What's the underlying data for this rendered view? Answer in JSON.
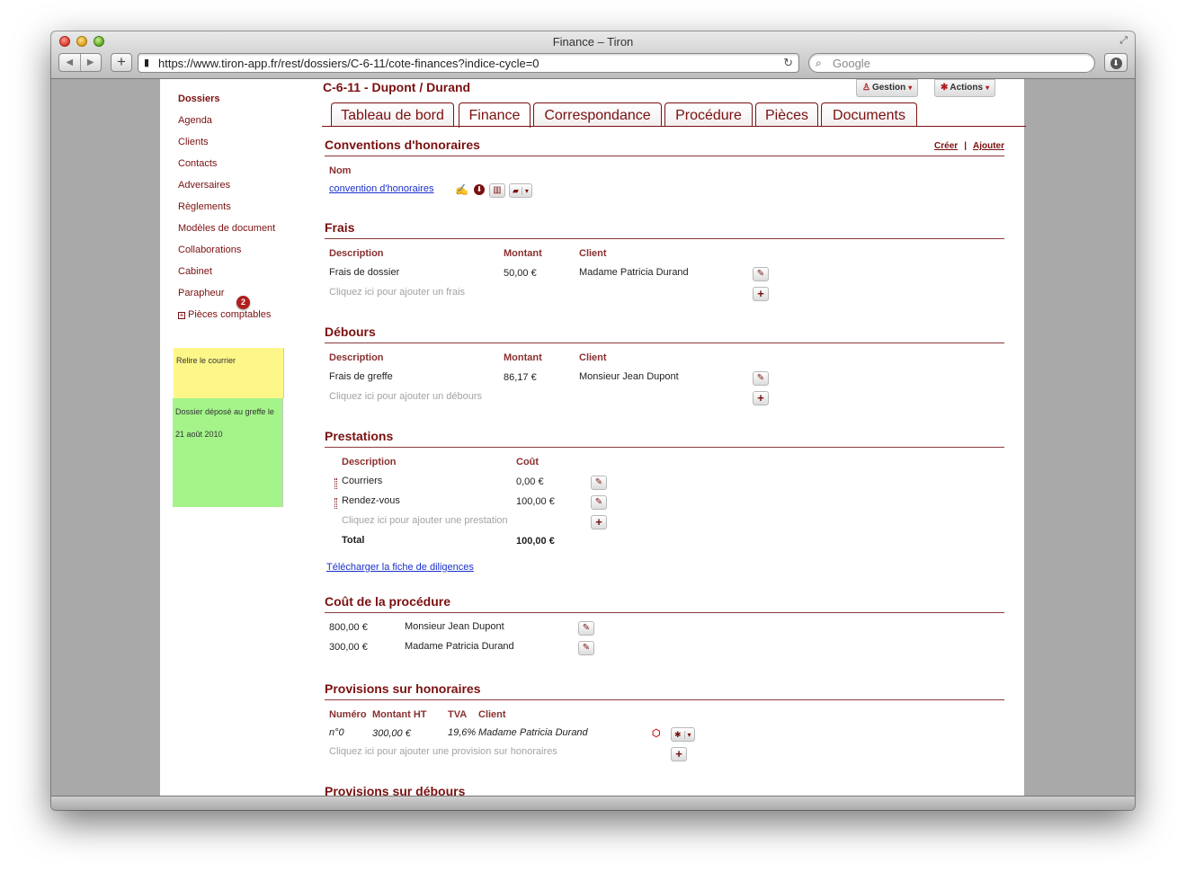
{
  "window": {
    "title": "Finance – Tiron"
  },
  "browser": {
    "url": "https://www.tiron-app.fr/rest/dossiers/C-6-11/cote-finances?indice-cycle=0",
    "search_placeholder": "Google",
    "back": "◀",
    "forward": "▶",
    "add": "+"
  },
  "sidebar": {
    "items": [
      "Dossiers",
      "Agenda",
      "Clients",
      "Contacts",
      "Adversaires",
      "Règlements",
      "Modèles de document",
      "Collaborations",
      "Cabinet",
      "Parapheur"
    ],
    "parapheur_badge": "2",
    "pieces": "Pièces comptables",
    "tree_toggle": "+"
  },
  "notes": {
    "yellow": "Relire le courrier",
    "green_line1": "Dossier déposé au greffe le",
    "green_line2": "21 août 2010"
  },
  "header": {
    "dossier": "C-6-11 - Dupont / Durand",
    "gestion": "Gestion",
    "actions": "Actions"
  },
  "tabs": [
    "Tableau de bord",
    "Finance",
    "Correspondance",
    "Procédure",
    "Pièces",
    "Documents"
  ],
  "active_tab": "Finance",
  "conventions": {
    "title": "Conventions d'honoraires",
    "creer": "Créer",
    "sep": "|",
    "ajouter": "Ajouter",
    "col_nom": "Nom",
    "doc": "convention d'honoraires"
  },
  "frais": {
    "title": "Frais",
    "cols": [
      "Description",
      "Montant",
      "Client"
    ],
    "row": {
      "description": "Frais de dossier",
      "montant": "50,00 €",
      "client": "Madame Patricia Durand"
    },
    "hint": "Cliquez ici pour ajouter un frais"
  },
  "debours": {
    "title": "Débours",
    "cols": [
      "Description",
      "Montant",
      "Client"
    ],
    "row": {
      "description": "Frais de greffe",
      "montant": "86,17 €",
      "client": "Monsieur Jean Dupont"
    },
    "hint": "Cliquez ici pour ajouter un débours"
  },
  "prestations": {
    "title": "Prestations",
    "cols": [
      "Description",
      "Coût"
    ],
    "rows": [
      {
        "description": "Courriers",
        "cout": "0,00 €"
      },
      {
        "description": "Rendez-vous",
        "cout": "100,00 €"
      }
    ],
    "hint": "Cliquez ici pour ajouter une prestation",
    "total_label": "Total",
    "total_value": "100,00 €",
    "download": "Télécharger la fiche de diligences"
  },
  "cout_procedure": {
    "title": "Coût de la procédure",
    "rows": [
      {
        "montant": "800,00 €",
        "client": "Monsieur Jean Dupont"
      },
      {
        "montant": "300,00 €",
        "client": "Madame Patricia Durand"
      }
    ]
  },
  "provisions_honoraires": {
    "title": "Provisions sur honoraires",
    "cols": [
      "Numéro",
      "Montant HT",
      "TVA",
      "Client"
    ],
    "row": {
      "numero": "n°0",
      "montant": "300,00 €",
      "tva": "19,6%",
      "client": "Madame Patricia Durand"
    },
    "hint": "Cliquez ici pour ajouter une provision sur honoraires"
  },
  "provisions_debours": {
    "title": "Provisions sur débours"
  },
  "icons": {
    "edit": "✎",
    "plus": "+",
    "caret": "▾",
    "pdf": "⬚",
    "gear": "✱",
    "download": "⬇",
    "trash": "🗑",
    "folder": "▭",
    "reload": "↻",
    "lock": "🔒",
    "search": "⌕"
  },
  "colors": {
    "accent": "#7a1010",
    "link": "#1a2fcc",
    "note_yellow": "#fdf78a",
    "note_green": "#a4f48a"
  }
}
